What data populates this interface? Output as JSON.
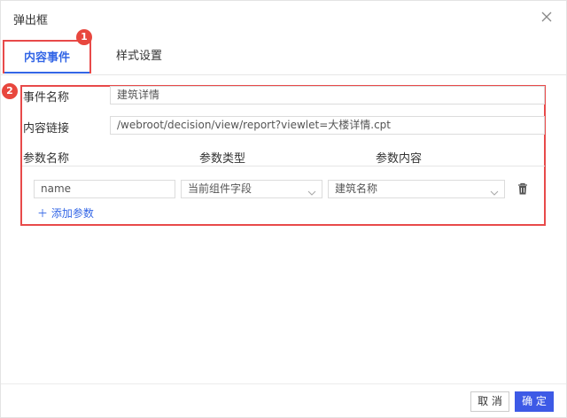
{
  "dialog": {
    "title": "弹出框"
  },
  "tabs": [
    {
      "label": "内容事件",
      "active": true
    },
    {
      "label": "样式设置",
      "active": false
    }
  ],
  "badges": [
    "1",
    "2"
  ],
  "form": {
    "event_name_label": "事件名称",
    "event_name_value": "建筑详情",
    "content_link_label": "内容链接",
    "content_link_value": "/webroot/decision/view/report?viewlet=大楼详情.cpt"
  },
  "params": {
    "headers": [
      "参数名称",
      "参数类型",
      "参数内容"
    ],
    "rows": [
      {
        "name": "name",
        "type": "当前组件字段",
        "content": "建筑名称"
      }
    ],
    "add_label": "＋ 添加参数"
  },
  "footer": {
    "cancel_label": "取 消",
    "ok_label": "确 定"
  },
  "colors": {
    "accent": "#3366e6",
    "annotation_red": "#e84a4a",
    "primary_button": "#3d5ae6"
  },
  "icons": [
    "close-icon",
    "chevron-down-icon",
    "trash-icon",
    "plus-icon"
  ]
}
